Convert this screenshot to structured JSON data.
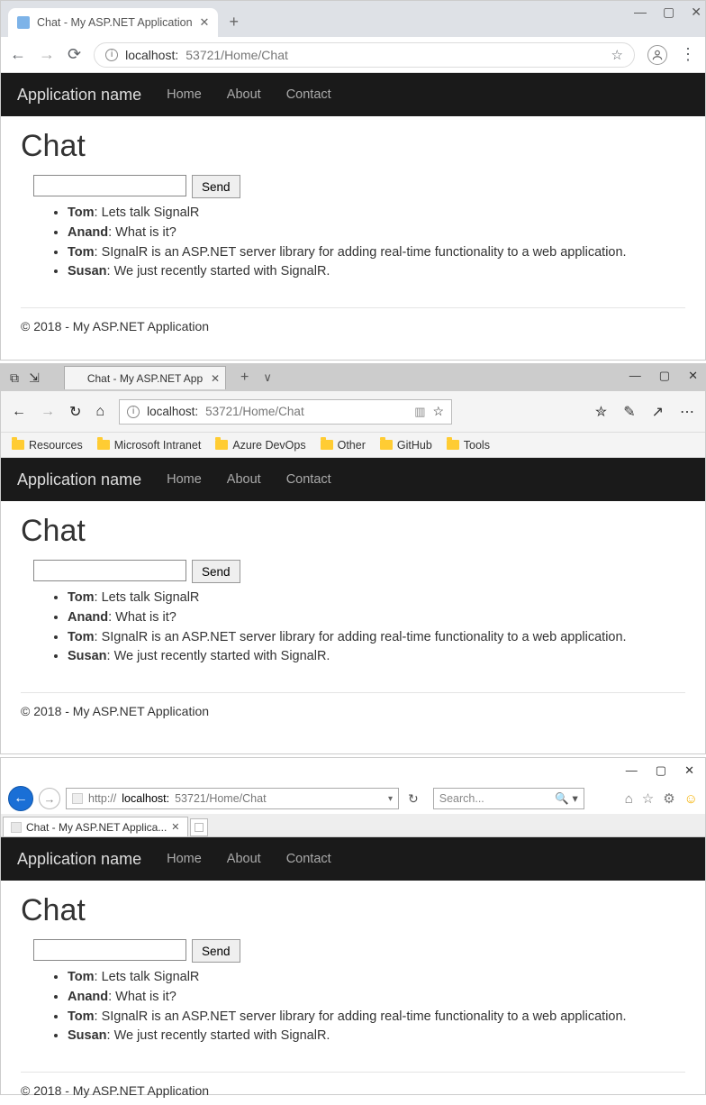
{
  "chrome": {
    "tab_title": "Chat - My ASP.NET Application",
    "url_host": "localhost:",
    "url_rest": "53721/Home/Chat"
  },
  "edge": {
    "tab_title": "Chat - My ASP.NET App",
    "url_host": "localhost:",
    "url_rest": "53721/Home/Chat",
    "bookmarks": [
      "Resources",
      "Microsoft Intranet",
      "Azure DevOps",
      "Other",
      "GitHub",
      "Tools"
    ]
  },
  "ie": {
    "tab_title": "Chat - My ASP.NET Applica...",
    "url_proto": "http://",
    "url_host": "localhost:",
    "url_rest": "53721/Home/Chat",
    "search_placeholder": "Search..."
  },
  "app": {
    "brand": "Application name",
    "nav": [
      "Home",
      "About",
      "Contact"
    ],
    "page_title": "Chat",
    "send_label": "Send",
    "messages": [
      {
        "user": "Tom",
        "text": "Lets talk SignalR"
      },
      {
        "user": "Anand",
        "text": "What is it?"
      },
      {
        "user": "Tom",
        "text": "SIgnalR is an ASP.NET server library for adding real-time functionality to a web application."
      },
      {
        "user": "Susan",
        "text": "We just recently started with SignalR."
      }
    ],
    "footer": "© 2018 - My ASP.NET Application"
  }
}
